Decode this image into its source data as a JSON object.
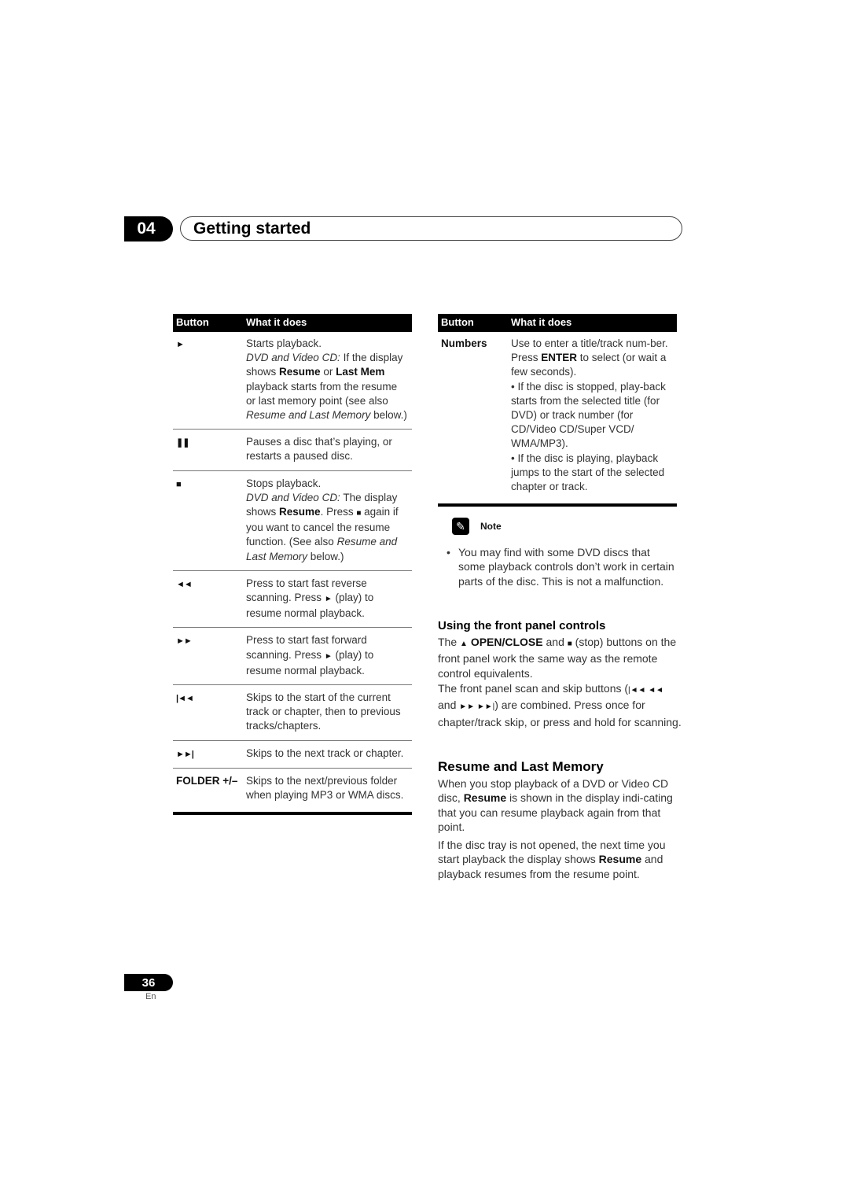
{
  "header": {
    "chapter_number": "04",
    "chapter_title": "Getting started"
  },
  "table_left": {
    "col_button": "Button",
    "col_what": "What it does",
    "rows": [
      {
        "icon": "play-icon",
        "symbol": "►",
        "line1": "Starts playback.",
        "italic1": "DVD and Video CD:",
        "text1": " If the display shows ",
        "bold1": "Resume",
        "text2": " or ",
        "bold2": "Last Mem",
        "text3": " playback starts from the resume or last memory point (see also ",
        "italic2": "Resume and Last Memory",
        "text4": " below.)"
      },
      {
        "icon": "pause-icon",
        "symbol": "❚❚",
        "text": "Pauses a disc that’s playing, or restarts a paused disc."
      },
      {
        "icon": "stop-icon",
        "symbol": "■",
        "line1": "Stops playback.",
        "italic1": "DVD and Video CD:",
        "text1": " The display shows ",
        "bold1": "Resume",
        "text2": ". Press ",
        "sym": "■",
        "text3": " again if you want to cancel the resume function. (See also ",
        "italic2": "Resume and Last Memory",
        "text4": " below.)"
      },
      {
        "icon": "fast-reverse-icon",
        "symbol": "◄◄",
        "text1": "Press to start fast reverse scanning. Press ",
        "sym": "►",
        "text2": " (play) to resume normal playback."
      },
      {
        "icon": "fast-forward-icon",
        "symbol": "►►",
        "text1": "Press to start fast forward scanning. Press ",
        "sym": "►",
        "text2": " (play) to resume normal playback."
      },
      {
        "icon": "skip-previous-icon",
        "symbol": "|◄◄",
        "text": "Skips to the start of the current track or chapter, then to previous tracks/chapters."
      },
      {
        "icon": "skip-next-icon",
        "symbol": "►►|",
        "text": "Skips to the next track or chapter."
      },
      {
        "label": "FOLDER +/–",
        "text": "Skips to the next/previous folder when playing MP3 or WMA discs."
      }
    ]
  },
  "table_right": {
    "col_button": "Button",
    "col_what": "What it does",
    "rows": [
      {
        "label": "Numbers",
        "text1": "Use to enter a title/track num-ber. Press ",
        "bold1": "ENTER",
        "text2": " to select (or wait a few seconds).",
        "bullet1": "• If the disc is stopped, play-back starts from the selected title (for DVD) or track number (for CD/Video CD/Super VCD/ WMA/MP3).",
        "bullet2": "• If the disc is playing, playback jumps to the start of the selected chapter or track."
      }
    ]
  },
  "note": {
    "label": "Note",
    "items": [
      "You may find with some DVD discs that some playback controls don’t work in certain parts of the disc. This is not a malfunction."
    ]
  },
  "front_panel": {
    "heading": "Using the front panel controls",
    "p1_a": "The ",
    "p1_eject": "▲",
    "p1_bold": "OPEN/CLOSE",
    "p1_b": " and ",
    "p1_stop": "■",
    "p1_c": " (stop) buttons on the front panel work the same way as the remote control equivalents.",
    "p2_a": "The front panel scan and skip buttons (",
    "p2_sym1": "|◄◄ ◄◄",
    "p2_b": " and ",
    "p2_sym2": "►► ►►|",
    "p2_c": ") are combined. Press once for chapter/track skip, or press and hold for scanning."
  },
  "resume": {
    "heading": "Resume and Last Memory",
    "p1_a": "When you stop playback of a DVD or Video CD disc, ",
    "p1_bold": "Resume",
    "p1_b": " is shown in the display indi-cating that you can resume playback again from that point.",
    "p2_a": "If the disc tray is not opened, the next time you start playback the display shows ",
    "p2_bold": "Resume",
    "p2_b": " and playback resumes from the resume point."
  },
  "footer": {
    "page_number": "36",
    "language": "En"
  }
}
